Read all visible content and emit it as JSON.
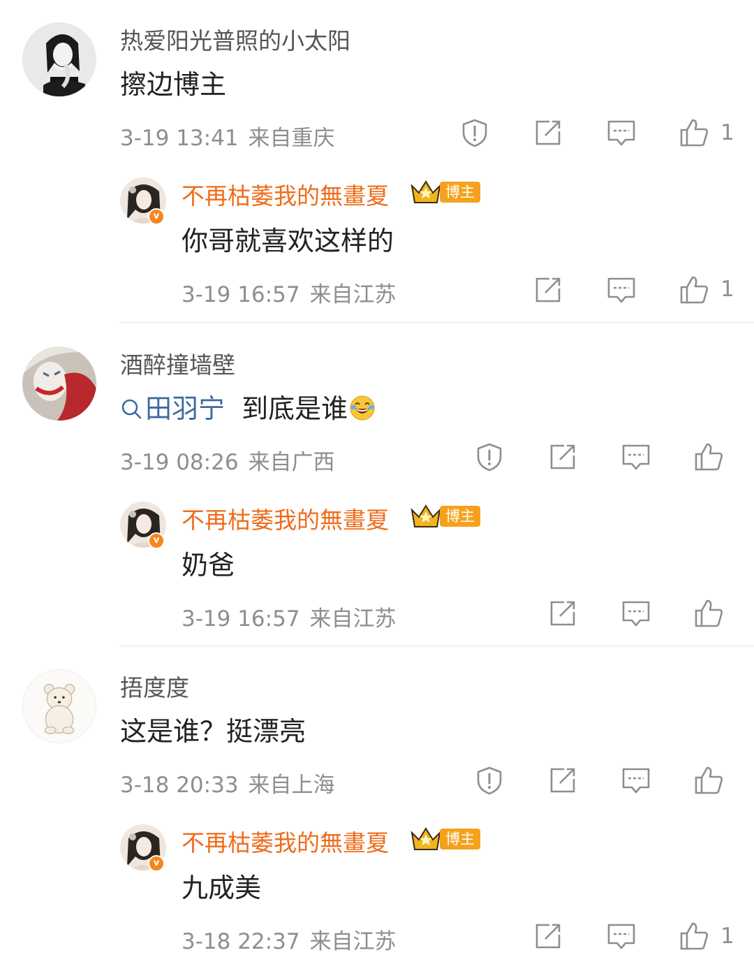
{
  "threads": [
    {
      "comment": {
        "username": "热爱阳光普照的小太阳",
        "text": "擦边博主",
        "date": "3-19 13:41",
        "location": "来自重庆",
        "like_count": "1",
        "avatar": "woman-photo-bw"
      },
      "reply": {
        "username": "不再枯萎我的無畫夏",
        "role": "博主",
        "text": "你哥就喜欢这样的",
        "date": "3-19 16:57",
        "location": "来自江苏",
        "like_count": "1"
      }
    },
    {
      "comment": {
        "username": "酒醉撞墙壁",
        "mention": "田羽宁",
        "text": "到底是谁",
        "date": "3-19 08:26",
        "location": "来自广西",
        "like_count": "",
        "avatar": "joker-photo"
      },
      "reply": {
        "username": "不再枯萎我的無畫夏",
        "role": "博主",
        "text": "奶爸",
        "date": "3-19 16:57",
        "location": "来自江苏",
        "like_count": ""
      }
    },
    {
      "comment": {
        "username": "捂度度",
        "text": "这是谁？挺漂亮",
        "date": "3-18 20:33",
        "location": "来自上海",
        "like_count": "",
        "avatar": "bear-illustration"
      },
      "reply": {
        "username": "不再枯萎我的無畫夏",
        "role": "博主",
        "text": "九成美",
        "date": "3-18 22:37",
        "location": "来自江苏",
        "like_count": "1"
      }
    }
  ],
  "author_badge_letter": "v",
  "icons": {
    "report": "shield-alert-icon",
    "share": "share-icon",
    "comment": "comment-icon",
    "like": "thumbs-up-icon",
    "mention": "search-icon",
    "emoji": "laughing-tears-emoji"
  },
  "colors": {
    "author_name": "#ef6c1a",
    "meta_text": "#8e8e8e",
    "mention": "#3d6aa3",
    "role_badge": "#f5a11e"
  }
}
